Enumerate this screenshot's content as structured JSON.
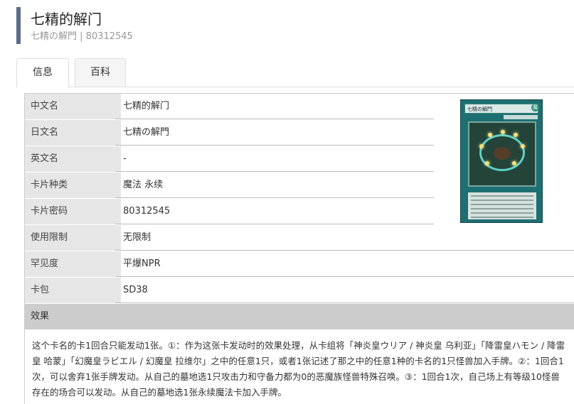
{
  "header": {
    "title": "七精的解门",
    "subtitle": "七精の解門 | 80312545"
  },
  "tabs": [
    {
      "label": "信息",
      "active": true
    },
    {
      "label": "百科",
      "active": false
    }
  ],
  "fields": [
    {
      "label": "中文名",
      "value": "七精的解门"
    },
    {
      "label": "日文名",
      "value": "七精の解門"
    },
    {
      "label": "英文名",
      "value": "-"
    },
    {
      "label": "卡片种类",
      "value": "魔法 永续"
    },
    {
      "label": "卡片密码",
      "value": "80312545"
    },
    {
      "label": "使用限制",
      "value": "无限制"
    },
    {
      "label": "罕见度",
      "value": "平爆NPR"
    },
    {
      "label": "卡包",
      "value": "SD38"
    }
  ],
  "effect": {
    "label": "效果",
    "text": "这个卡名的卡1回合只能发动1张。①：作为这张卡发动时的效果处理，从卡组将「神炎皇ウリア / 神炎皇 乌利亚」「降雷皇ハモン / 降雷皇 哈蒙」「幻魔皇ラビエル / 幻魔皇 拉维尔」之中的任意1只，或者1张记述了那之中的任意1种的卡名的1只怪兽加入手牌。②：1回合1次，可以舍弃1张手牌发动。从自己的墓地选1只攻击力和守备力都为0的恶魔族怪兽特殊召唤。③：1回合1次，自己场上有等级10怪兽存在的场合可以发动。从自己的墓地选1张永续魔法卡加入手牌。"
  },
  "card_image": {
    "name": "七精の解門",
    "attribute": "魔"
  },
  "colors": {
    "accent": "#5a6b8c",
    "label_bg": "#e6e6e6",
    "effect_head_bg": "#cccccc"
  }
}
